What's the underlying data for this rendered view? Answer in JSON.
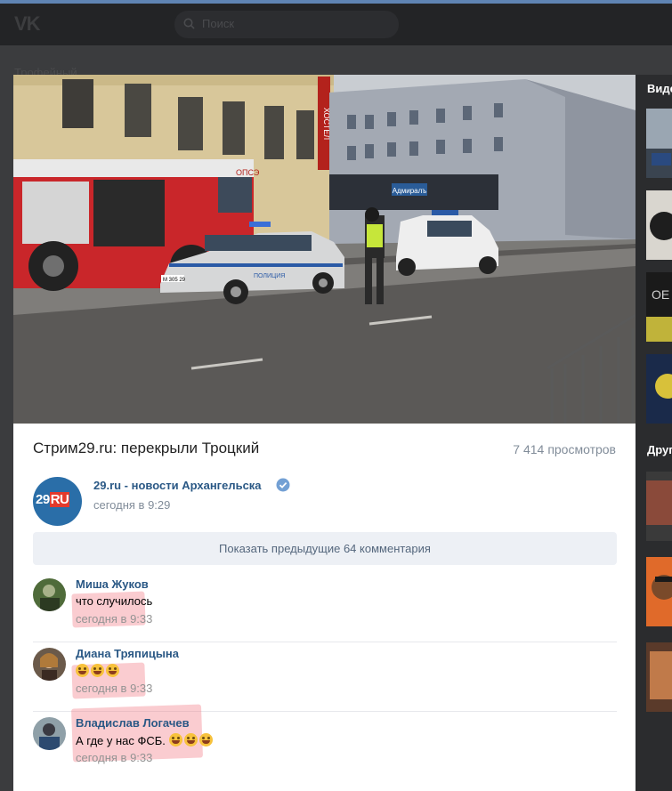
{
  "header": {
    "logo": "VK",
    "search_placeholder": "Поиск"
  },
  "background": {
    "heading": "Трофейный..."
  },
  "video": {
    "title": "Стрим29.ru: перекрыли Троцкий",
    "views_count": "7 414",
    "views_label": "просмотров",
    "scene_text": {
      "fire_truck_side": "ОПСЭ",
      "police_car": "ПОЛИЦИЯ",
      "plate": "М 305 29",
      "hostel_sign": "ХОСТЕЛ",
      "shop_sign": "Адмиралъ"
    }
  },
  "channel": {
    "avatar_text_main": "29",
    "avatar_text_suffix": "RU",
    "name": "29.ru - новости Архангельска",
    "time": "сегодня в 9:29"
  },
  "show_previous_label": "Показать предыдущие 64 комментария",
  "comments": [
    {
      "author": "Миша Жуков",
      "text": "что случилось",
      "emoji_count": 0,
      "time": "сегодня в 9:33"
    },
    {
      "author": "Диана Тряпицына",
      "text": "",
      "emoji_count": 3,
      "time": "сегодня в 9:33"
    },
    {
      "author": "Владислав Логачев",
      "text": "А где у нас ФСБ.",
      "emoji_count": 3,
      "time": "сегодня в 9:33"
    }
  ],
  "sidebar": {
    "section1_label": "Видео",
    "section2_label": "Другие"
  },
  "colors": {
    "link": "#2a5885",
    "muted": "#818c99",
    "highlight": "#f06e78"
  }
}
